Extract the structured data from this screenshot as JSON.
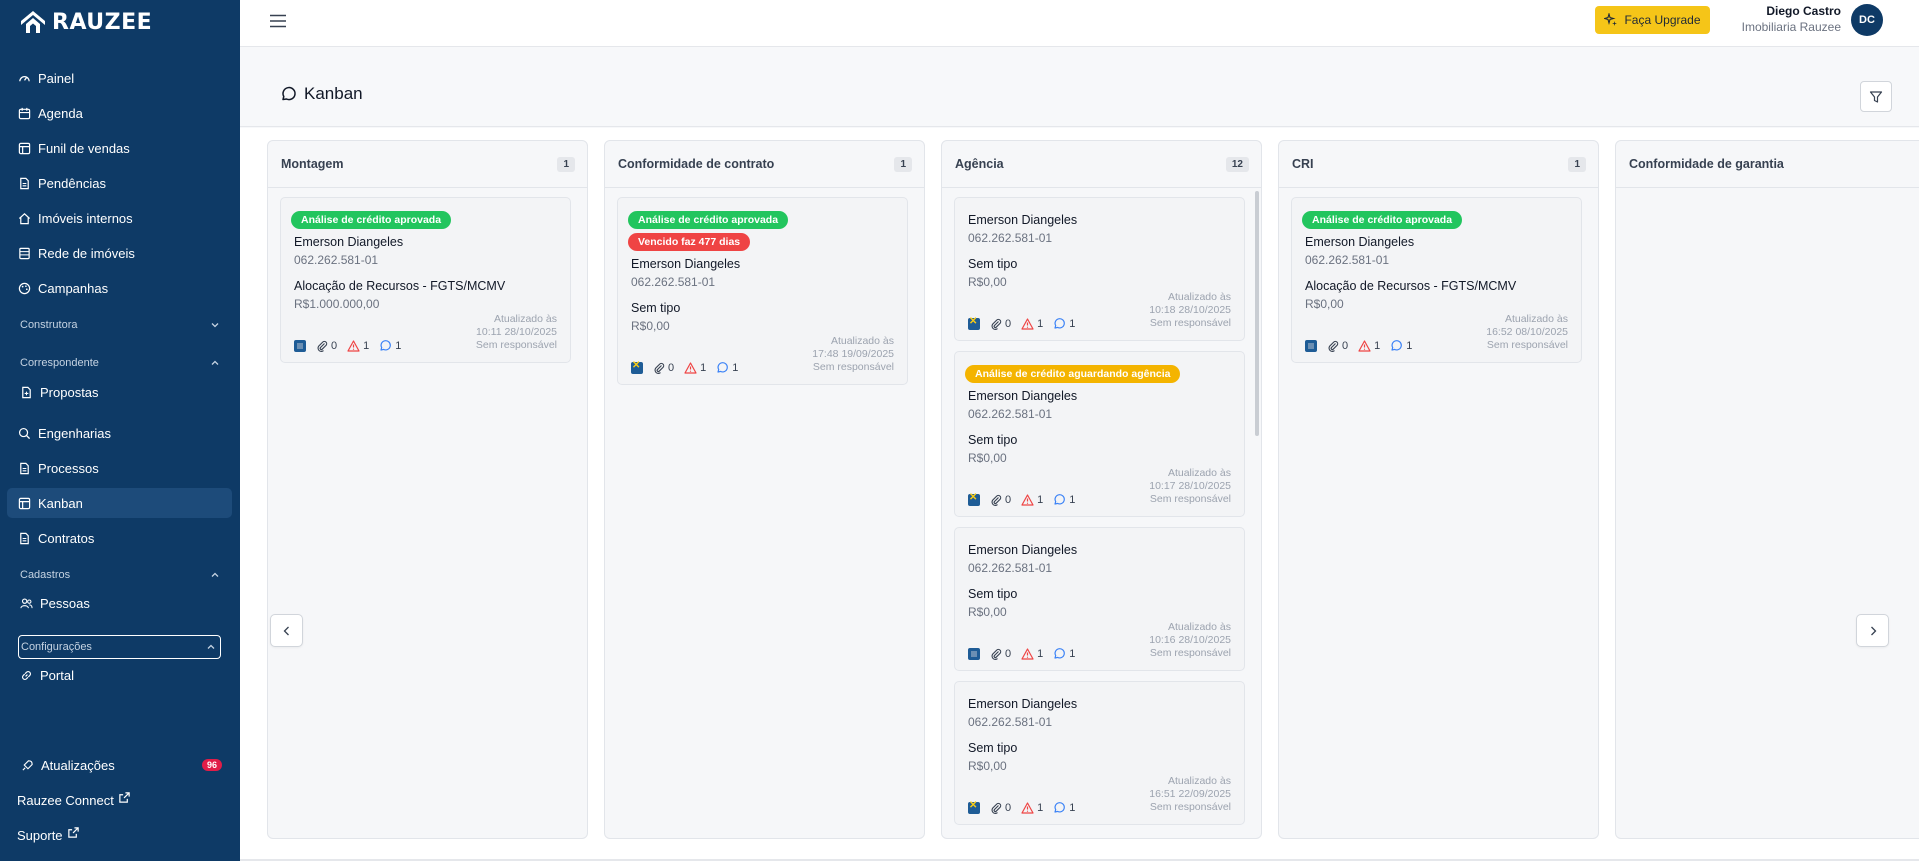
{
  "brand": {
    "name": "RAUZEE"
  },
  "sidebar": {
    "items": [
      {
        "label": "Painel"
      },
      {
        "label": "Agenda"
      },
      {
        "label": "Funil de vendas"
      },
      {
        "label": "Pendências"
      },
      {
        "label": "Imóveis internos"
      },
      {
        "label": "Rede de imóveis"
      },
      {
        "label": "Campanhas"
      },
      {
        "label": "Propostas"
      },
      {
        "label": "Engenharias"
      },
      {
        "label": "Processos"
      },
      {
        "label": "Kanban"
      },
      {
        "label": "Contratos"
      },
      {
        "label": "Pessoas"
      },
      {
        "label": "Portal"
      }
    ],
    "sections": [
      {
        "label": "Construtora"
      },
      {
        "label": "Correspondente"
      },
      {
        "label": "Cadastros"
      },
      {
        "label": "Configurações"
      }
    ],
    "bottom": {
      "updates_label": "Atualizações",
      "updates_count": "96",
      "connect_label": "Rauzee Connect",
      "support_label": "Suporte"
    }
  },
  "header": {
    "upgrade_label": "Faça Upgrade",
    "user_name": "Diego Castro",
    "user_org": "Imobiliaria Rauzee",
    "avatar_initials": "DC"
  },
  "page": {
    "title": "Kanban"
  },
  "columns": [
    {
      "title": "Montagem",
      "count": "1",
      "cards": [
        {
          "tags": [
            {
              "text": "Análise de crédito aprovada",
              "color": "green"
            }
          ],
          "name": "Emerson Diangeles",
          "cpf": "062.262.581-01",
          "type": "Alocação de Recursos - FGTS/MCMV",
          "value": "R$1.000.000,00",
          "bank": "sq",
          "attachments": "0",
          "alerts": "1",
          "comments": "1",
          "updated_label": "Atualizado às",
          "updated": "10:11 28/10/2025",
          "owner": "Sem responsável"
        }
      ]
    },
    {
      "title": "Conformidade de contrato",
      "count": "1",
      "cards": [
        {
          "tags": [
            {
              "text": "Análise de crédito aprovada",
              "color": "green"
            },
            {
              "text": "Vencido faz 477 dias",
              "color": "red"
            }
          ],
          "name": "Emerson Diangeles",
          "cpf": "062.262.581-01",
          "type": "Sem tipo",
          "value": "R$0,00",
          "bank": "x",
          "attachments": "0",
          "alerts": "1",
          "comments": "1",
          "updated_label": "Atualizado às",
          "updated": "17:48 19/09/2025",
          "owner": "Sem responsável"
        }
      ]
    },
    {
      "title": "Agência",
      "count": "12",
      "cards": [
        {
          "tags": [],
          "name": "Emerson Diangeles",
          "cpf": "062.262.581-01",
          "type": "Sem tipo",
          "value": "R$0,00",
          "bank": "x",
          "attachments": "0",
          "alerts": "1",
          "comments": "1",
          "updated_label": "Atualizado às",
          "updated": "10:18 28/10/2025",
          "owner": "Sem responsável"
        },
        {
          "tags": [
            {
              "text": "Análise de crédito aguardando agência",
              "color": "amber"
            }
          ],
          "name": "Emerson Diangeles",
          "cpf": "062.262.581-01",
          "type": "Sem tipo",
          "value": "R$0,00",
          "bank": "x",
          "attachments": "0",
          "alerts": "1",
          "comments": "1",
          "updated_label": "Atualizado às",
          "updated": "10:17 28/10/2025",
          "owner": "Sem responsável"
        },
        {
          "tags": [],
          "name": "Emerson Diangeles",
          "cpf": "062.262.581-01",
          "type": "Sem tipo",
          "value": "R$0,00",
          "bank": "sq",
          "attachments": "0",
          "alerts": "1",
          "comments": "1",
          "updated_label": "Atualizado às",
          "updated": "10:16 28/10/2025",
          "owner": "Sem responsável"
        },
        {
          "tags": [],
          "name": "Emerson Diangeles",
          "cpf": "062.262.581-01",
          "type": "Sem tipo",
          "value": "R$0,00",
          "bank": "x",
          "attachments": "0",
          "alerts": "1",
          "comments": "1",
          "updated_label": "Atualizado às",
          "updated": "16:51 22/09/2025",
          "owner": "Sem responsável"
        }
      ]
    },
    {
      "title": "CRI",
      "count": "1",
      "cards": [
        {
          "tags": [
            {
              "text": "Análise de crédito aprovada",
              "color": "green"
            }
          ],
          "name": "Emerson Diangeles",
          "cpf": "062.262.581-01",
          "type": "Alocação de Recursos - FGTS/MCMV",
          "value": "R$0,00",
          "bank": "sq",
          "attachments": "0",
          "alerts": "1",
          "comments": "1",
          "updated_label": "Atualizado às",
          "updated": "16:52 08/10/2025",
          "owner": "Sem responsável"
        }
      ]
    },
    {
      "title": "Conformidade de garantia",
      "count": "",
      "cards": []
    }
  ],
  "colors": {
    "sidebar_bg": "#0e3a66",
    "approved": "#22c55e",
    "overdue": "#ef4444",
    "pending": "#f4b400",
    "upgrade": "#f5c518"
  }
}
